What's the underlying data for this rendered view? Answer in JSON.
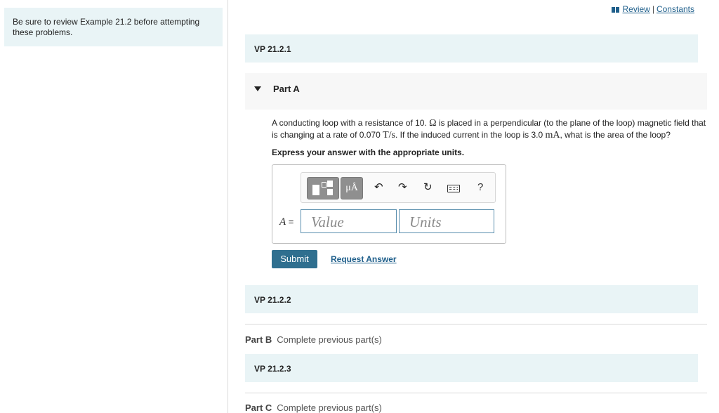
{
  "sidebar": {
    "note": "Be  sure to review Example 21.2 before attempting these problems."
  },
  "topbar": {
    "review": "Review",
    "separator": "|",
    "constants": "Constants"
  },
  "sections": {
    "vp1": "VP 21.2.1",
    "vp2": "VP 21.2.2",
    "vp3": "VP 21.2.3"
  },
  "partA": {
    "title": "Part A",
    "question_a": "A conducting loop with a resistance of 10. ",
    "question_ohm": "Ω",
    "question_b": " is placed in a perpendicular (to the plane of the loop) magnetic field that is changing at a rate of 0.070 ",
    "question_rate_unit": "T/s",
    "question_c": ". If the induced current in the loop is 3.0 ",
    "question_current_unit": "mA",
    "question_d": ", what is the area of the loop?",
    "express": "Express your answer with the appropriate units.",
    "answer_label": "A",
    "answer_eq": " =",
    "value_placeholder": "Value",
    "units_placeholder": "Units",
    "units_button": "μÅ",
    "help_symbol": "?",
    "submit": "Submit",
    "request": "Request Answer"
  },
  "partB": {
    "label": "Part B",
    "status": "Complete previous part(s)"
  },
  "partC": {
    "label": "Part C",
    "status": "Complete previous part(s)"
  }
}
